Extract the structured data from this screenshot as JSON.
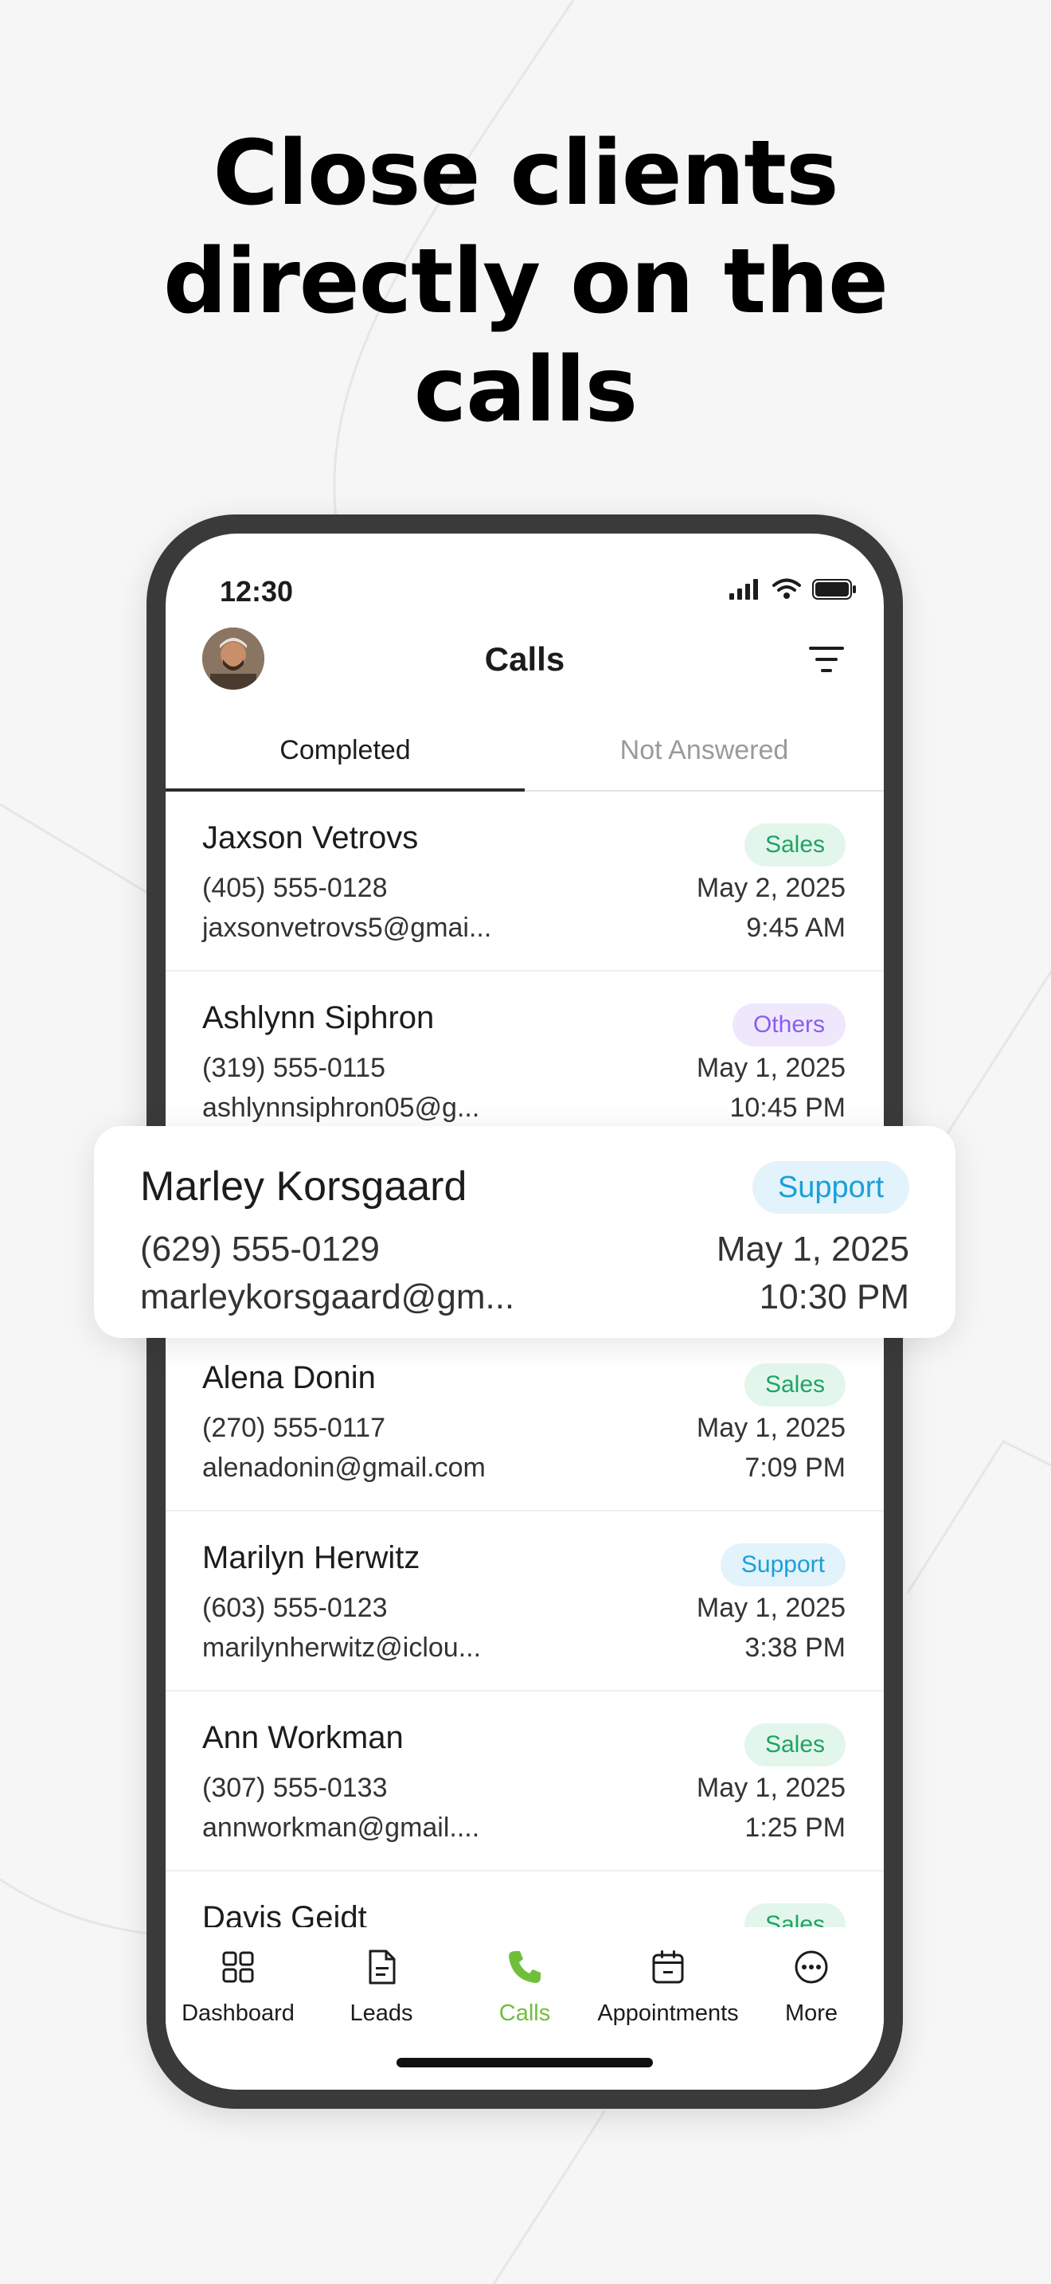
{
  "headline": {
    "line1": "Close clients",
    "line2": "directly on the",
    "line3": "calls"
  },
  "status_bar": {
    "time": "12:30"
  },
  "header": {
    "title": "Calls"
  },
  "tabs": [
    {
      "label": "Completed",
      "active": true
    },
    {
      "label": "Not Answered",
      "active": false
    }
  ],
  "calls": [
    {
      "name": "Jaxson Vetrovs",
      "phone": "(405) 555-0128",
      "email": "jaxsonvetrovs5@gmai...",
      "date": "May 2, 2025",
      "time": "9:45 AM",
      "tag": "Sales",
      "tag_type": "sales"
    },
    {
      "name": "Ashlynn Siphron",
      "phone": "(319) 555-0115",
      "email": "ashlynnsiphron05@g...",
      "date": "May 1, 2025",
      "time": "10:45 PM",
      "tag": "Others",
      "tag_type": "others"
    },
    {
      "name": "",
      "phone": "",
      "email": "",
      "date": "",
      "time": "",
      "tag": "",
      "tag_type": ""
    },
    {
      "name": "Alena Donin",
      "phone": "(270) 555-0117",
      "email": "alenadonin@gmail.com",
      "date": "May 1, 2025",
      "time": "7:09 PM",
      "tag": "Sales",
      "tag_type": "sales"
    },
    {
      "name": "Marilyn Herwitz",
      "phone": "(603) 555-0123",
      "email": "marilynherwitz@iclou...",
      "date": "May 1, 2025",
      "time": "3:38 PM",
      "tag": "Support",
      "tag_type": "support"
    },
    {
      "name": "Ann Workman",
      "phone": "(307) 555-0133",
      "email": "annworkman@gmail....",
      "date": "May 1, 2025",
      "time": "1:25 PM",
      "tag": "Sales",
      "tag_type": "sales"
    },
    {
      "name": "Davis Geidt",
      "phone": "",
      "email": "",
      "date": "",
      "time": "",
      "tag": "Sales",
      "tag_type": "sales"
    }
  ],
  "highlighted_call": {
    "name": "Marley Korsgaard",
    "phone": "(629) 555-0129",
    "email": "marleykorsgaard@gm...",
    "date": "May 1, 2025",
    "time": "10:30 PM",
    "tag": "Support"
  },
  "bottom_nav": [
    {
      "label": "Dashboard",
      "icon": "grid-icon",
      "active": false
    },
    {
      "label": "Leads",
      "icon": "document-icon",
      "active": false
    },
    {
      "label": "Calls",
      "icon": "phone-icon",
      "active": true
    },
    {
      "label": "Appointments",
      "icon": "calendar-icon",
      "active": false
    },
    {
      "label": "More",
      "icon": "more-icon",
      "active": false
    }
  ],
  "colors": {
    "accent_green": "#6fbf3a",
    "sales": "#1ea463",
    "others": "#8a5cf0",
    "support": "#1a9fd9"
  }
}
